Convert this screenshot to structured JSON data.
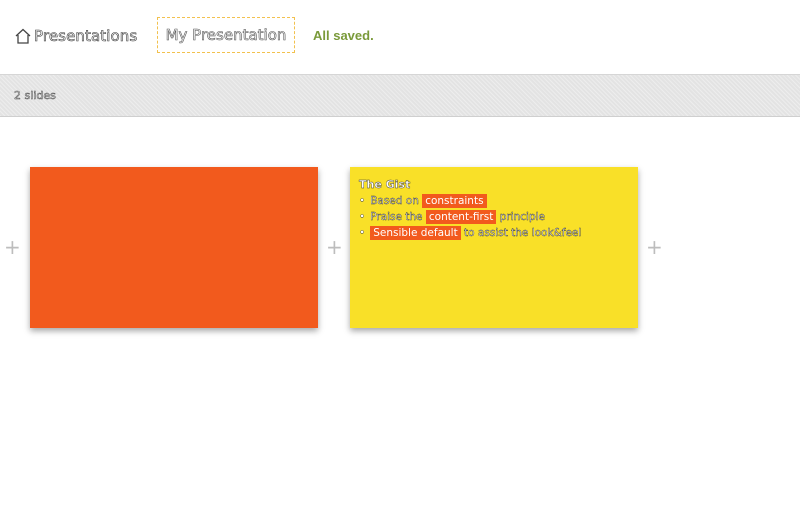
{
  "header": {
    "home_label": "Presentations",
    "title": "My Presentation",
    "save_status": "All saved."
  },
  "toolbar": {
    "slide_count": "2 slides"
  },
  "slides": [
    {
      "background": "#f25a1d"
    },
    {
      "background": "#f9e028",
      "title": "The Gist",
      "bullets": [
        {
          "before": "Based on",
          "highlight": "constraints",
          "after": ""
        },
        {
          "before": "Praise the",
          "highlight": "content-first",
          "after": "principle"
        },
        {
          "before": "",
          "highlight": "Sensible default",
          "after": "to assist the look&feel"
        }
      ]
    }
  ],
  "add_slide_symbol": "+",
  "colors": {
    "accent": "#f25a1d",
    "highlight_bg": "#f25a1d",
    "slide2_bg": "#f9e028",
    "status": "#7a9a3a",
    "title_border": "#f2c14e"
  },
  "icons": {
    "home": "home-icon"
  }
}
